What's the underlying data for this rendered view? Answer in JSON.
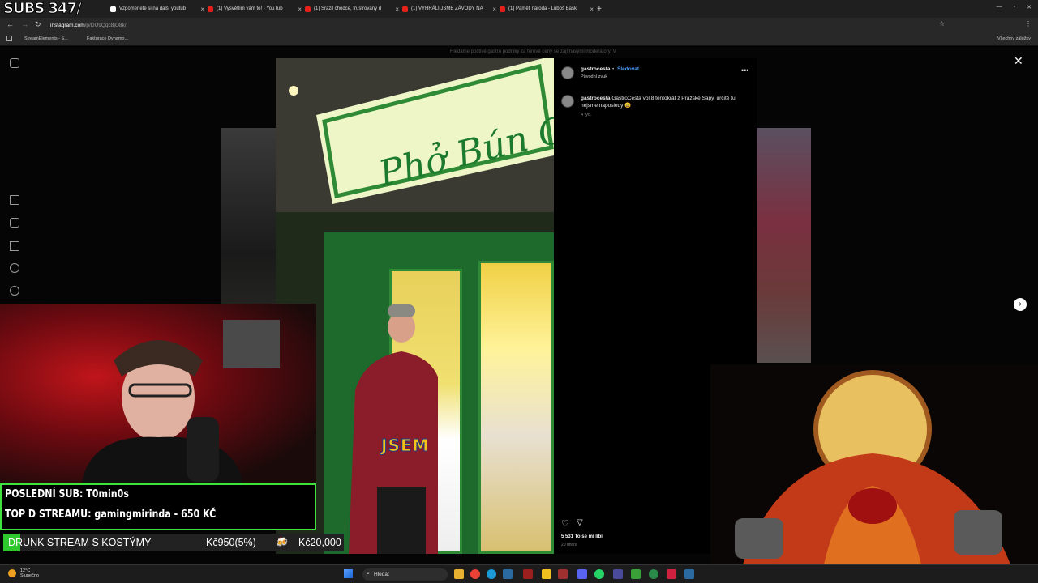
{
  "stream": {
    "subs_counter": "SUBS 347/"
  },
  "browser": {
    "tabs": [
      {
        "label": "Vzpomenete si na další youtub"
      },
      {
        "label": "(1) Vysvětlím vám to! - YouTub"
      },
      {
        "label": "(1) Srazil chodce, frustrovaný d"
      },
      {
        "label": "(1) VYHRÁLI JSME ZÁVODY NA"
      },
      {
        "label": "(1) Paměť národa - Luboš Bašk"
      }
    ],
    "url_host": "instagram.com",
    "url_path": "/p/DU9Qqc8jO8k/",
    "bookmarks": [
      {
        "label": "StreamElements - S..."
      },
      {
        "label": "Fakturace Dynamo..."
      }
    ],
    "all_bookmarks": "Všechny záložky"
  },
  "instagram": {
    "top_caption_fragment": "Hledáme počtivé gastro podniky za férové ceny se zajímavými moderátory. V",
    "username": "gastrocesta",
    "follow_label": "Sledovat",
    "original_sound": "Původní zvuk",
    "caption_user": "gastrocesta",
    "caption_text": "GastroCesta vol.8 tentokrát z Pražské Sapy, určitě tu nejsme naposledy 😄",
    "caption_age": "4 týd.",
    "likes": "5 531 To se mi líbí",
    "post_date": "20 února",
    "video_overlay_word": "JSEM",
    "sign_text": "Phở Bún Ca Nam Định"
  },
  "overlay": {
    "last_sub": "POSLEDNÍ SUB: T0min0s",
    "top_donator": "TOP D STREAMU: gamingmirinda - 650 KČ",
    "goal_label": "DRUNK STREAM S KOSTÝMY",
    "goal_current": "Kč950(5%)",
    "goal_target": "Kč20,000",
    "goal_fraction": 0.05
  },
  "taskbar": {
    "temp": "12°C",
    "weather": "Slunečno",
    "search_placeholder": "Hledat"
  }
}
